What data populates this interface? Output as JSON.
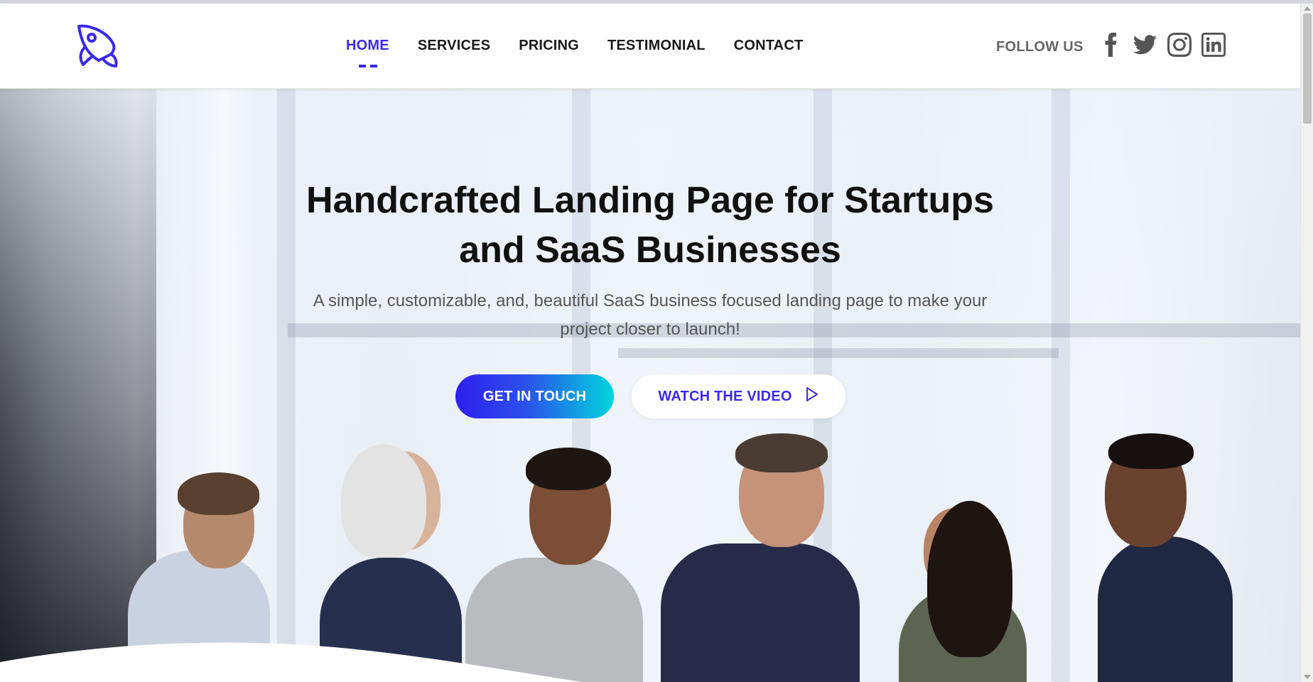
{
  "nav": {
    "logo_icon": "rocket-icon",
    "items": [
      {
        "label": "HOME",
        "active": true
      },
      {
        "label": "SERVICES"
      },
      {
        "label": "PRICING"
      },
      {
        "label": "TESTIMONIAL"
      },
      {
        "label": "CONTACT"
      }
    ],
    "follow_label": "FOLLOW US",
    "socials": [
      "facebook-icon",
      "twitter-icon",
      "instagram-icon",
      "linkedin-icon"
    ]
  },
  "hero": {
    "title_line1": "Handcrafted Landing Page for Startups",
    "title_line2": "and SaaS Businesses",
    "subtitle_line1": "A simple, customizable, and, beautiful SaaS business focused landing page to make your",
    "subtitle_line2": "project closer to launch!",
    "primary_button": "GET IN TOUCH",
    "secondary_button": "WATCH THE VIDEO",
    "secondary_icon": "play-icon"
  },
  "colors": {
    "accent": "#3a2ae8",
    "gradient_start": "#2f1fee",
    "gradient_end": "#00d6dc",
    "text_dark": "#111111",
    "text_muted": "#555555"
  }
}
